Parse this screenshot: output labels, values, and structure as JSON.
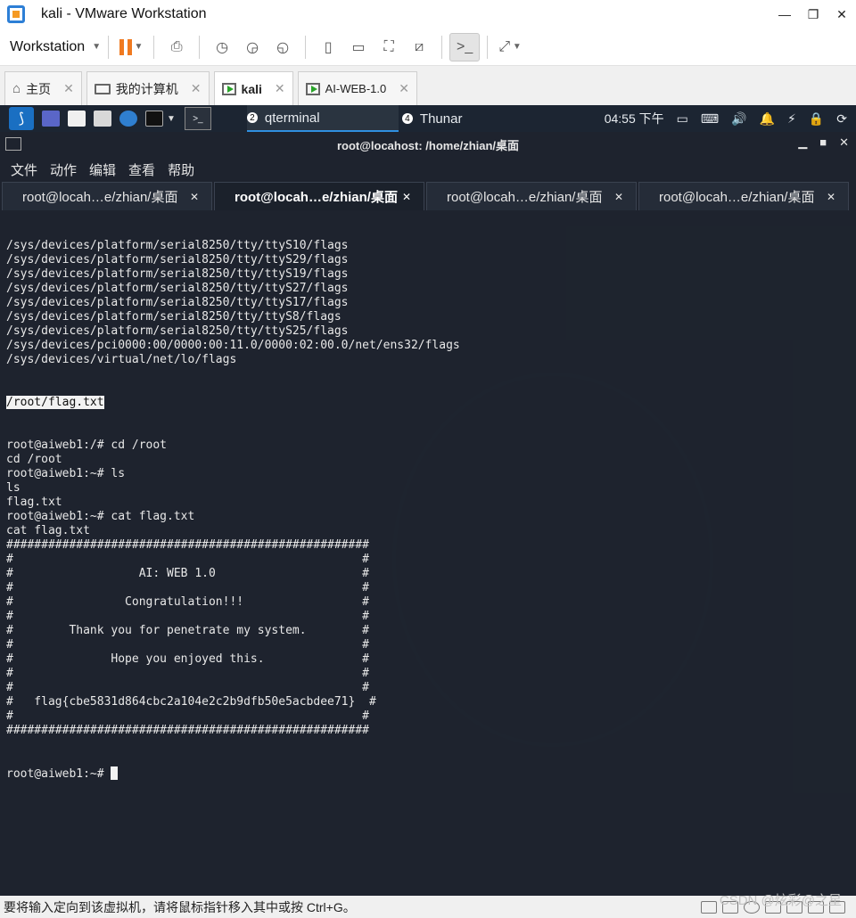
{
  "window": {
    "title": "kali - VMware Workstation",
    "controls": [
      "—",
      "❐",
      "✕"
    ]
  },
  "toolbar": {
    "menu_label": "Workstation"
  },
  "vm_tabs": [
    {
      "label": "主页",
      "icon": "home-icon"
    },
    {
      "label": "我的计算机",
      "icon": "monitor-icon"
    },
    {
      "label": "kali",
      "icon": "vm-running-icon",
      "active": true
    },
    {
      "label": "AI-WEB-1.0",
      "icon": "vm-running-icon"
    }
  ],
  "kali_panel": {
    "tasks": [
      {
        "label": "qterminal",
        "badge": "2"
      },
      {
        "label": "Thunar",
        "badge": "4"
      }
    ],
    "clock": "04:55 下午"
  },
  "terminal": {
    "title": "root@locahost: /home/zhian/桌面",
    "menu": [
      "文件",
      "动作",
      "编辑",
      "查看",
      "帮助"
    ],
    "tabs": [
      {
        "label": "root@locah…e/zhian/桌面"
      },
      {
        "label": "root@locah…e/zhian/桌面",
        "active": true
      },
      {
        "label": "root@locah…e/zhian/桌面"
      },
      {
        "label": "root@locah…e/zhian/桌面"
      }
    ],
    "lines_before": [
      "/sys/devices/platform/serial8250/tty/ttyS10/flags",
      "/sys/devices/platform/serial8250/tty/ttyS29/flags",
      "/sys/devices/platform/serial8250/tty/ttyS19/flags",
      "/sys/devices/platform/serial8250/tty/ttyS27/flags",
      "/sys/devices/platform/serial8250/tty/ttyS17/flags",
      "/sys/devices/platform/serial8250/tty/ttyS8/flags",
      "/sys/devices/platform/serial8250/tty/ttyS25/flags",
      "/sys/devices/pci0000:00/0000:00:11.0/0000:02:00.0/net/ens32/flags",
      "/sys/devices/virtual/net/lo/flags"
    ],
    "highlighted_line": "/root/flag.txt",
    "lines_after": [
      "root@aiweb1:/# cd /root",
      "cd /root",
      "root@aiweb1:~# ls",
      "ls",
      "flag.txt",
      "root@aiweb1:~# cat flag.txt",
      "cat flag.txt",
      "####################################################",
      "#                                                  #",
      "#                  AI: WEB 1.0                     #",
      "#                                                  #",
      "#                Congratulation!!!                 #",
      "#                                                  #",
      "#        Thank you for penetrate my system.        #",
      "#                                                  #",
      "#              Hope you enjoyed this.              #",
      "#                                                  #",
      "#                                                  #",
      "#   flag{cbe5831d864cbc2a104e2c2b9dfb50e5acbdee71}  #",
      "#                                                  #",
      "####################################################"
    ],
    "prompt": "root@aiweb1:~# "
  },
  "statusbar": {
    "message": "要将输入定向到该虚拟机，请将鼠标指针移入其中或按 Ctrl+G。"
  },
  "watermark": "CSDN @炫彩@之星"
}
